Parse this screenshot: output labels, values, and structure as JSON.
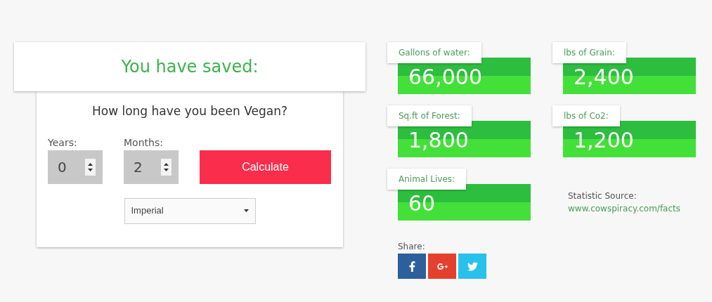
{
  "header": {
    "title": "You have saved:"
  },
  "form": {
    "question": "How long have you been Vegan?",
    "years": {
      "label": "Years:",
      "value": "0"
    },
    "months": {
      "label": "Months:",
      "value": "2"
    },
    "button": "Calculate",
    "units": {
      "value": "Imperial"
    }
  },
  "stats": [
    {
      "label": "Gallons of water:",
      "value": "66,000"
    },
    {
      "label": "lbs of Grain:",
      "value": "2,400"
    },
    {
      "label": "Sq.ft of Forest:",
      "value": "1,800"
    },
    {
      "label": "lbs of Co2:",
      "value": "1,200"
    },
    {
      "label": "Animal Lives:",
      "value": "60"
    }
  ],
  "source": {
    "label": "Statistic Source:",
    "link": "www.cowspiracy.com/facts"
  },
  "share": {
    "label": "Share:",
    "buttons": [
      {
        "kind": "facebook",
        "color": "#2d5f9a"
      },
      {
        "kind": "google",
        "color": "#e4402f"
      },
      {
        "kind": "twitter",
        "color": "#29c0ec"
      }
    ]
  }
}
